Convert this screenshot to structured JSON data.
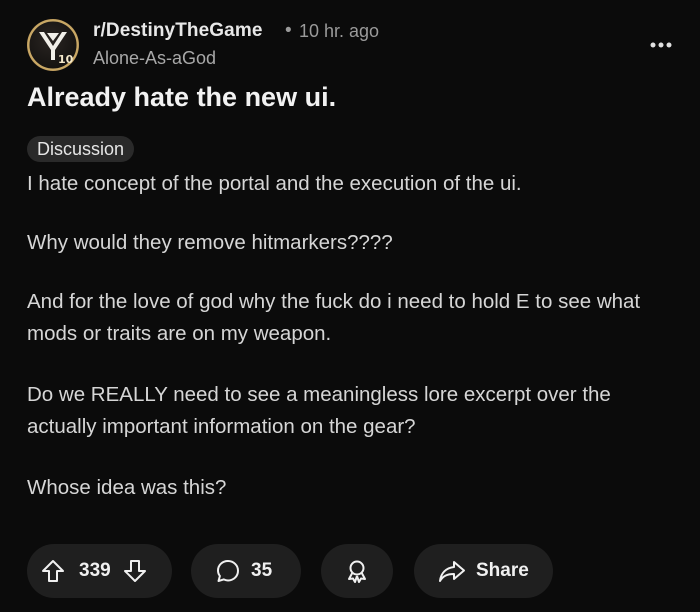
{
  "post": {
    "subreddit": "r/DestinyTheGame",
    "separator": "•",
    "time_ago": "10 hr. ago",
    "author": "Alone-As-aGod",
    "avatar_badge": "10",
    "title": "Already hate the new ui.",
    "flair": "Discussion",
    "body": [
      "I hate concept of the portal and the execution of the ui.",
      "Why would they remove hitmarkers????",
      "And for the love of god why the fuck do i need to hold E to see what mods or traits are on my weapon.",
      "Do we REALLY need to see a meaningless lore excerpt over the actually important information on the gear?",
      "Whose idea was this?"
    ]
  },
  "actions": {
    "votes": "339",
    "comments": "35",
    "share_label": "Share"
  },
  "icons": {
    "avatar": "destiny-logo-icon",
    "overflow": "more-options-icon",
    "upvote": "arrow-up-icon",
    "downvote": "arrow-down-icon",
    "comment": "comment-bubble-icon",
    "award": "award-icon",
    "share": "share-arrow-icon"
  },
  "colors": {
    "background": "#0b0b0b",
    "pill": "#1f1f1f",
    "flair_bg": "#2a2a2a",
    "avatar_ring": "#b8975b"
  }
}
